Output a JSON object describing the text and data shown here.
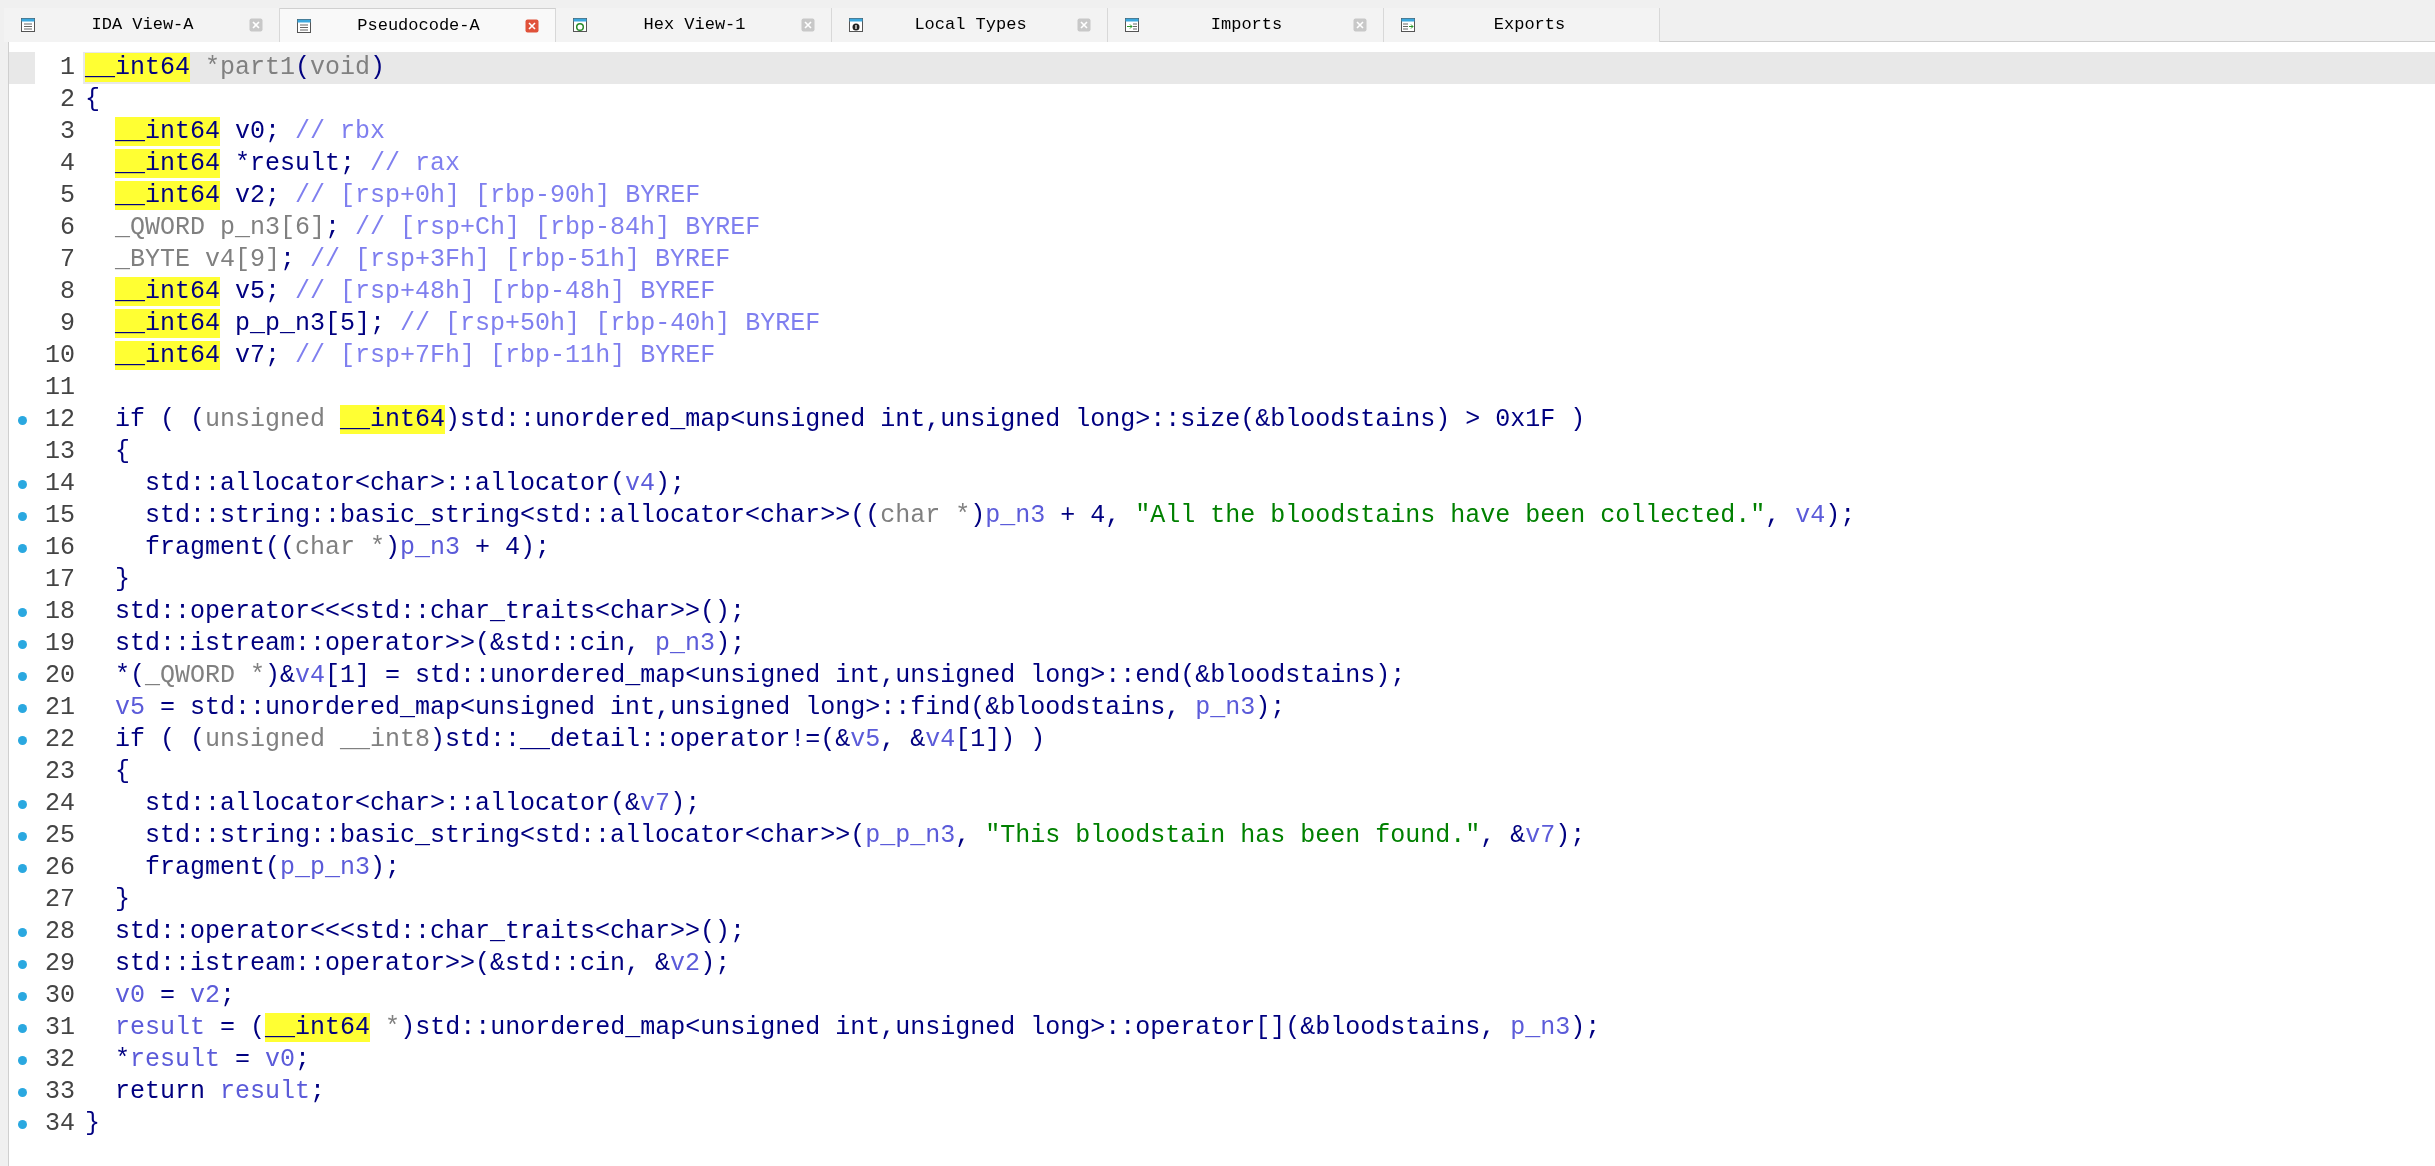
{
  "tabs": [
    {
      "label": "IDA View-A",
      "selected": false,
      "closable": true
    },
    {
      "label": "Pseudocode-A",
      "selected": true,
      "closable": true
    },
    {
      "label": "Hex View-1",
      "selected": false,
      "closable": true
    },
    {
      "label": "Local Types",
      "selected": false,
      "closable": true
    },
    {
      "label": "Imports",
      "selected": false,
      "closable": true
    },
    {
      "label": "Exports",
      "selected": false,
      "closable": false
    }
  ],
  "code": {
    "lines": [
      {
        "number": "1",
        "dot": false,
        "current": true,
        "tokens": [
          {
            "kind": "highlight",
            "text": "__int64"
          },
          {
            "kind": "type",
            "text": " *part1"
          },
          {
            "kind": "plain",
            "text": "("
          },
          {
            "kind": "type",
            "text": "void"
          },
          {
            "kind": "plain",
            "text": ")"
          }
        ]
      },
      {
        "number": "2",
        "dot": false,
        "current": false,
        "tokens": [
          {
            "kind": "plain",
            "text": "{"
          }
        ]
      },
      {
        "number": "3",
        "dot": false,
        "current": false,
        "tokens": [
          {
            "kind": "highlight",
            "text": "  __int64"
          },
          {
            "kind": "plain",
            "text": " v0; "
          },
          {
            "kind": "comment",
            "text": "// rbx"
          }
        ]
      },
      {
        "number": "4",
        "dot": false,
        "current": false,
        "tokens": [
          {
            "kind": "highlight",
            "text": "  __int64"
          },
          {
            "kind": "plain",
            "text": " *result; "
          },
          {
            "kind": "comment",
            "text": "// rax"
          }
        ]
      },
      {
        "number": "5",
        "dot": false,
        "current": false,
        "tokens": [
          {
            "kind": "highlight",
            "text": "  __int64"
          },
          {
            "kind": "plain",
            "text": " v2; "
          },
          {
            "kind": "comment",
            "text": "// [rsp+0h] [rbp-90h] BYREF"
          }
        ]
      },
      {
        "number": "6",
        "dot": false,
        "current": false,
        "tokens": [
          {
            "kind": "type",
            "text": "  _QWORD p_n3[6]"
          },
          {
            "kind": "plain",
            "text": "; "
          },
          {
            "kind": "comment",
            "text": "// [rsp+Ch] [rbp-84h] BYREF"
          }
        ]
      },
      {
        "number": "7",
        "dot": false,
        "current": false,
        "tokens": [
          {
            "kind": "type",
            "text": "  _BYTE v4[9]"
          },
          {
            "kind": "plain",
            "text": "; "
          },
          {
            "kind": "comment",
            "text": "// [rsp+3Fh] [rbp-51h] BYREF"
          }
        ]
      },
      {
        "number": "8",
        "dot": false,
        "current": false,
        "tokens": [
          {
            "kind": "highlight",
            "text": "  __int64"
          },
          {
            "kind": "plain",
            "text": " v5; "
          },
          {
            "kind": "comment",
            "text": "// [rsp+48h] [rbp-48h] BYREF"
          }
        ]
      },
      {
        "number": "9",
        "dot": false,
        "current": false,
        "tokens": [
          {
            "kind": "highlight",
            "text": "  __int64"
          },
          {
            "kind": "plain",
            "text": " p_p_n3[5]; "
          },
          {
            "kind": "comment",
            "text": "// [rsp+50h] [rbp-40h] BYREF"
          }
        ]
      },
      {
        "number": "10",
        "dot": false,
        "current": false,
        "tokens": [
          {
            "kind": "highlight",
            "text": "  __int64"
          },
          {
            "kind": "plain",
            "text": " v7; "
          },
          {
            "kind": "comment",
            "text": "// [rsp+7Fh] [rbp-11h] BYREF"
          }
        ]
      },
      {
        "number": "11",
        "dot": false,
        "current": false
      },
      {
        "number": "12",
        "dot": true,
        "current": false,
        "tokens": [
          {
            "kind": "plain",
            "text": "  if ( ("
          },
          {
            "kind": "type",
            "text": "unsigned "
          },
          {
            "kind": "highlight",
            "text": "__int64"
          },
          {
            "kind": "plain",
            "text": ")std::unordered_map<unsigned int,unsigned long>::size(&bloodstains) > 0x1F )"
          }
        ]
      },
      {
        "number": "13",
        "dot": false,
        "current": false,
        "tokens": [
          {
            "kind": "plain",
            "text": "  {"
          }
        ]
      },
      {
        "number": "14",
        "dot": true,
        "current": false,
        "tokens": [
          {
            "kind": "plain",
            "text": "    std::allocator<char>::allocator("
          },
          {
            "kind": "var",
            "text": "v4"
          },
          {
            "kind": "plain",
            "text": ");"
          }
        ]
      },
      {
        "number": "15",
        "dot": true,
        "current": false,
        "tokens": [
          {
            "kind": "plain",
            "text": "    std::string::basic_string<std::allocator<char>>(("
          },
          {
            "kind": "type",
            "text": "char *"
          },
          {
            "kind": "plain",
            "text": ")"
          },
          {
            "kind": "var",
            "text": "p_n3"
          },
          {
            "kind": "plain",
            "text": " + 4, "
          },
          {
            "kind": "string",
            "text": "\"All the bloodstains have been collected.\""
          },
          {
            "kind": "plain",
            "text": ", "
          },
          {
            "kind": "var",
            "text": "v4"
          },
          {
            "kind": "plain",
            "text": ");"
          }
        ]
      },
      {
        "number": "16",
        "dot": true,
        "current": false,
        "tokens": [
          {
            "kind": "plain",
            "text": "    fragment(("
          },
          {
            "kind": "type",
            "text": "char *"
          },
          {
            "kind": "plain",
            "text": ")"
          },
          {
            "kind": "var",
            "text": "p_n3"
          },
          {
            "kind": "plain",
            "text": " + 4);"
          }
        ]
      },
      {
        "number": "17",
        "dot": false,
        "current": false,
        "tokens": [
          {
            "kind": "plain",
            "text": "  }"
          }
        ]
      },
      {
        "number": "18",
        "dot": true,
        "current": false,
        "tokens": [
          {
            "kind": "plain",
            "text": "  std::operator<<<std::char_traits<char>>();"
          }
        ]
      },
      {
        "number": "19",
        "dot": true,
        "current": false,
        "tokens": [
          {
            "kind": "plain",
            "text": "  std::istream::operator>>(&std::cin, "
          },
          {
            "kind": "var",
            "text": "p_n3"
          },
          {
            "kind": "plain",
            "text": ");"
          }
        ]
      },
      {
        "number": "20",
        "dot": true,
        "current": false,
        "tokens": [
          {
            "kind": "plain",
            "text": "  *("
          },
          {
            "kind": "type",
            "text": "_QWORD *"
          },
          {
            "kind": "plain",
            "text": ")&"
          },
          {
            "kind": "var",
            "text": "v4"
          },
          {
            "kind": "plain",
            "text": "[1] = std::unordered_map<unsigned int,unsigned long>::end(&bloodstains);"
          }
        ]
      },
      {
        "number": "21",
        "dot": true,
        "current": false,
        "tokens": [
          {
            "kind": "var",
            "text": "  v5"
          },
          {
            "kind": "plain",
            "text": " = std::unordered_map<unsigned int,unsigned long>::find(&bloodstains, "
          },
          {
            "kind": "var",
            "text": "p_n3"
          },
          {
            "kind": "plain",
            "text": ");"
          }
        ]
      },
      {
        "number": "22",
        "dot": true,
        "current": false,
        "tokens": [
          {
            "kind": "plain",
            "text": "  if ( ("
          },
          {
            "kind": "type",
            "text": "unsigned __int8"
          },
          {
            "kind": "plain",
            "text": ")std::__detail::operator!=(&"
          },
          {
            "kind": "var",
            "text": "v5"
          },
          {
            "kind": "plain",
            "text": ", &"
          },
          {
            "kind": "var",
            "text": "v4"
          },
          {
            "kind": "plain",
            "text": "[1]) )"
          }
        ]
      },
      {
        "number": "23",
        "dot": false,
        "current": false,
        "tokens": [
          {
            "kind": "plain",
            "text": "  {"
          }
        ]
      },
      {
        "number": "24",
        "dot": true,
        "current": false,
        "tokens": [
          {
            "kind": "plain",
            "text": "    std::allocator<char>::allocator(&"
          },
          {
            "kind": "var",
            "text": "v7"
          },
          {
            "kind": "plain",
            "text": ");"
          }
        ]
      },
      {
        "number": "25",
        "dot": true,
        "current": false,
        "tokens": [
          {
            "kind": "plain",
            "text": "    std::string::basic_string<std::allocator<char>>("
          },
          {
            "kind": "var",
            "text": "p_p_n3"
          },
          {
            "kind": "plain",
            "text": ", "
          },
          {
            "kind": "string",
            "text": "\"This bloodstain has been found.\""
          },
          {
            "kind": "plain",
            "text": ", &"
          },
          {
            "kind": "var",
            "text": "v7"
          },
          {
            "kind": "plain",
            "text": ");"
          }
        ]
      },
      {
        "number": "26",
        "dot": true,
        "current": false,
        "tokens": [
          {
            "kind": "plain",
            "text": "    fragment("
          },
          {
            "kind": "var",
            "text": "p_p_n3"
          },
          {
            "kind": "plain",
            "text": ");"
          }
        ]
      },
      {
        "number": "27",
        "dot": false,
        "current": false,
        "tokens": [
          {
            "kind": "plain",
            "text": "  }"
          }
        ]
      },
      {
        "number": "28",
        "dot": true,
        "current": false,
        "tokens": [
          {
            "kind": "plain",
            "text": "  std::operator<<<std::char_traits<char>>();"
          }
        ]
      },
      {
        "number": "29",
        "dot": true,
        "current": false,
        "tokens": [
          {
            "kind": "plain",
            "text": "  std::istream::operator>>(&std::cin, &"
          },
          {
            "kind": "var",
            "text": "v2"
          },
          {
            "kind": "plain",
            "text": ");"
          }
        ]
      },
      {
        "number": "30",
        "dot": true,
        "current": false,
        "tokens": [
          {
            "kind": "var",
            "text": "  v0"
          },
          {
            "kind": "plain",
            "text": " = "
          },
          {
            "kind": "var",
            "text": "v2"
          },
          {
            "kind": "plain",
            "text": ";"
          }
        ]
      },
      {
        "number": "31",
        "dot": true,
        "current": false,
        "tokens": [
          {
            "kind": "var",
            "text": "  result"
          },
          {
            "kind": "plain",
            "text": " = ("
          },
          {
            "kind": "highlight",
            "text": "__int64"
          },
          {
            "kind": "type",
            "text": " *"
          },
          {
            "kind": "plain",
            "text": ")std::unordered_map<unsigned int,unsigned long>::operator[](&bloodstains, "
          },
          {
            "kind": "var",
            "text": "p_n3"
          },
          {
            "kind": "plain",
            "text": ");"
          }
        ]
      },
      {
        "number": "32",
        "dot": true,
        "current": false,
        "tokens": [
          {
            "kind": "plain",
            "text": "  *"
          },
          {
            "kind": "var",
            "text": "result"
          },
          {
            "kind": "plain",
            "text": " = "
          },
          {
            "kind": "var",
            "text": "v0"
          },
          {
            "kind": "plain",
            "text": ";"
          }
        ]
      },
      {
        "number": "33",
        "dot": true,
        "current": false,
        "tokens": [
          {
            "kind": "plain",
            "text": "  return "
          },
          {
            "kind": "var",
            "text": "result"
          },
          {
            "kind": "plain",
            "text": ";"
          }
        ]
      },
      {
        "number": "34",
        "dot": true,
        "current": false,
        "tokens": [
          {
            "kind": "plain",
            "text": "}"
          }
        ]
      }
    ]
  }
}
